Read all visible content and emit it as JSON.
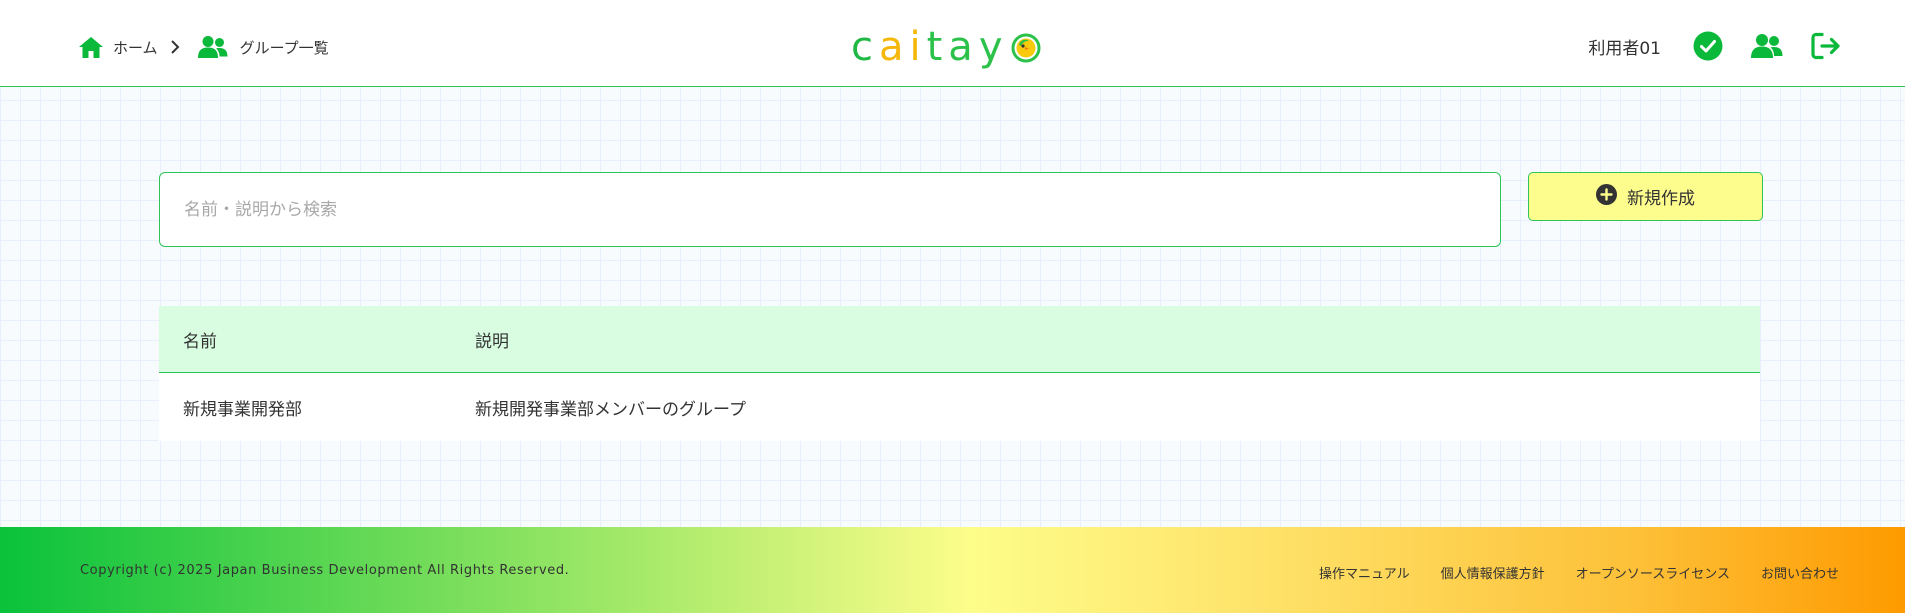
{
  "header": {
    "breadcrumb": {
      "home_label": "ホーム",
      "groups_label": "グループ一覧"
    },
    "logo_text_part1": "c",
    "logo_text_part2": "ai",
    "logo_text_part3": "tay",
    "logo_bird_letter": "o",
    "username": "利用者01",
    "icons": [
      "check-circle-icon",
      "users-icon",
      "logout-icon"
    ]
  },
  "search": {
    "placeholder": "名前・説明から検索",
    "value": ""
  },
  "create_button": {
    "label": "新規作成",
    "icon": "plus-circle-icon"
  },
  "table": {
    "columns": [
      "名前",
      "説明"
    ],
    "rows": [
      {
        "name": "新規事業開発部",
        "description": "新規開発事業部メンバーのグループ"
      }
    ]
  },
  "footer": {
    "copyright": "Copyright (c) 2025 Japan Business Development All Rights Reserved.",
    "links": [
      "操作マニュアル",
      "個人情報保護方針",
      "オープンソースライセンス",
      "お問い合わせ"
    ]
  },
  "colors": {
    "accent_green": "#2ec45a",
    "header_icon_green": "#0ab83a",
    "table_header_bg": "#d8fde1",
    "button_yellow": "#fdfd8e"
  }
}
